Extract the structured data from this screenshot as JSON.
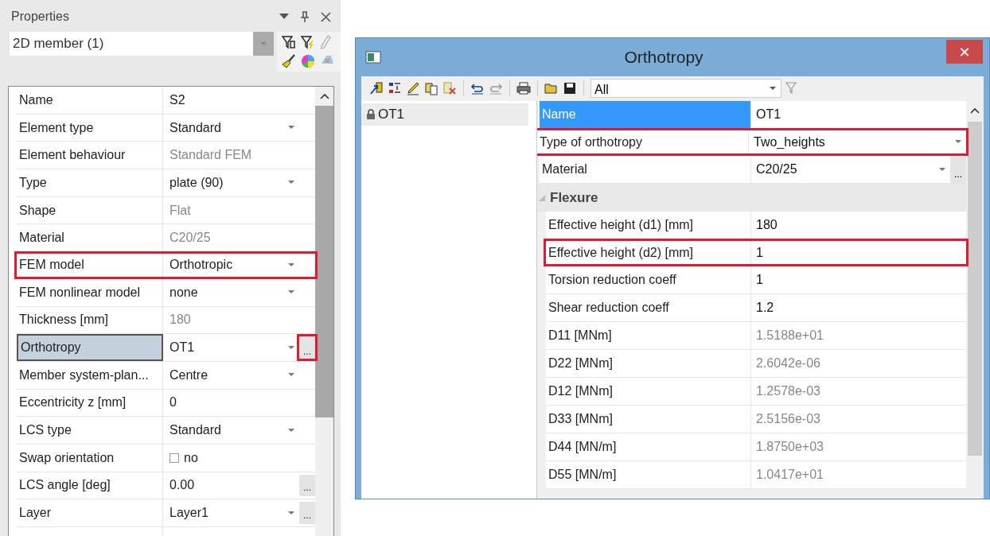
{
  "properties_panel": {
    "title": "Properties",
    "selector": {
      "value": "2D member (1)"
    },
    "rows": [
      {
        "label": "Name",
        "value": "S2",
        "kind": "text",
        "readonly": false,
        "selected": false,
        "highlighted": false
      },
      {
        "label": "Element type",
        "value": "Standard",
        "kind": "dropdown",
        "readonly": false,
        "selected": false,
        "highlighted": false
      },
      {
        "label": "Element behaviour",
        "value": "Standard FEM",
        "kind": "text",
        "readonly": true,
        "selected": false,
        "highlighted": false
      },
      {
        "label": "Type",
        "value": "plate (90)",
        "kind": "dropdown",
        "readonly": false,
        "selected": false,
        "highlighted": false
      },
      {
        "label": "Shape",
        "value": "Flat",
        "kind": "text",
        "readonly": true,
        "selected": false,
        "highlighted": false
      },
      {
        "label": "Material",
        "value": "C20/25",
        "kind": "text",
        "readonly": true,
        "selected": false,
        "highlighted": false
      },
      {
        "label": "FEM model",
        "value": "Orthotropic",
        "kind": "dropdown",
        "readonly": false,
        "selected": false,
        "highlighted": true
      },
      {
        "label": "FEM nonlinear model",
        "value": "none",
        "kind": "dropdown",
        "readonly": false,
        "selected": false,
        "highlighted": false
      },
      {
        "label": "Thickness [mm]",
        "value": "180",
        "kind": "text",
        "readonly": true,
        "selected": false,
        "highlighted": false
      },
      {
        "label": "Orthotropy",
        "value": "OT1",
        "kind": "dropdown-ellipsis",
        "ellipsis": {
          "text": "...",
          "highlighted": true
        },
        "readonly": false,
        "selected": true,
        "highlighted": false
      },
      {
        "label": "Member system-plan...",
        "value": "Centre",
        "kind": "dropdown",
        "readonly": false,
        "selected": false,
        "highlighted": false
      },
      {
        "label": "Eccentricity z [mm]",
        "value": "0",
        "kind": "text",
        "readonly": false,
        "selected": false,
        "highlighted": false
      },
      {
        "label": "LCS type",
        "value": "Standard",
        "kind": "dropdown",
        "readonly": false,
        "selected": false,
        "highlighted": false
      },
      {
        "label": "Swap orientation",
        "value": "no",
        "kind": "checkbox",
        "checked": false,
        "readonly": false,
        "selected": false,
        "highlighted": false
      },
      {
        "label": "LCS angle [deg]",
        "value": "0.00",
        "kind": "ellipsis",
        "ellipsis": {
          "text": "...",
          "highlighted": false
        },
        "readonly": false,
        "selected": false,
        "highlighted": false
      },
      {
        "label": "Layer",
        "value": "Layer1",
        "kind": "dropdown-ellipsis",
        "ellipsis": {
          "text": "...",
          "highlighted": false
        },
        "readonly": false,
        "selected": false,
        "highlighted": false
      }
    ]
  },
  "orthotropy_window": {
    "title": "Orthotropy",
    "close": "✕",
    "filter": {
      "value": "All"
    },
    "tree": [
      {
        "label": "OT1",
        "selected": true
      }
    ],
    "rows": [
      {
        "label": "Name",
        "value": "OT1",
        "kind": "text",
        "readonly": false,
        "selected": true,
        "highlighted": false
      },
      {
        "label": "Type of orthotropy",
        "value": "Two_heights",
        "kind": "dropdown",
        "readonly": false,
        "selected": false,
        "highlighted": true
      },
      {
        "label": "Material",
        "value": "C20/25",
        "kind": "dropdown-ellipsis",
        "ellipsis": {
          "text": "...",
          "highlighted": false
        },
        "readonly": false,
        "selected": false,
        "highlighted": false
      },
      {
        "label": "Flexure",
        "kind": "category",
        "expanded": true
      },
      {
        "label": "Effective height (d1) [mm]",
        "value": "180",
        "kind": "text",
        "readonly": false,
        "selected": false,
        "highlighted": false
      },
      {
        "label": "Effective height (d2) [mm]",
        "value": "1",
        "kind": "text",
        "readonly": false,
        "selected": false,
        "highlighted": true
      },
      {
        "label": "Torsion reduction coeff",
        "value": "1",
        "kind": "text",
        "readonly": false,
        "selected": false,
        "highlighted": false
      },
      {
        "label": "Shear reduction coeff",
        "value": "1.2",
        "kind": "text",
        "readonly": false,
        "selected": false,
        "highlighted": false
      },
      {
        "label": "D11 [MNm]",
        "value": "1.5188e+01",
        "kind": "text",
        "readonly": true,
        "selected": false,
        "highlighted": false
      },
      {
        "label": "D22 [MNm]",
        "value": "2.6042e-06",
        "kind": "text",
        "readonly": true,
        "selected": false,
        "highlighted": false
      },
      {
        "label": "D12 [MNm]",
        "value": "1.2578e-03",
        "kind": "text",
        "readonly": true,
        "selected": false,
        "highlighted": false
      },
      {
        "label": "D33 [MNm]",
        "value": "2.5156e-03",
        "kind": "text",
        "readonly": true,
        "selected": false,
        "highlighted": false
      },
      {
        "label": "D44 [MN/m]",
        "value": "1.8750e+03",
        "kind": "text",
        "readonly": true,
        "selected": false,
        "highlighted": false
      },
      {
        "label": "D55 [MN/m]",
        "value": "1.0417e+01",
        "kind": "text",
        "readonly": true,
        "selected": false,
        "highlighted": false
      }
    ]
  }
}
